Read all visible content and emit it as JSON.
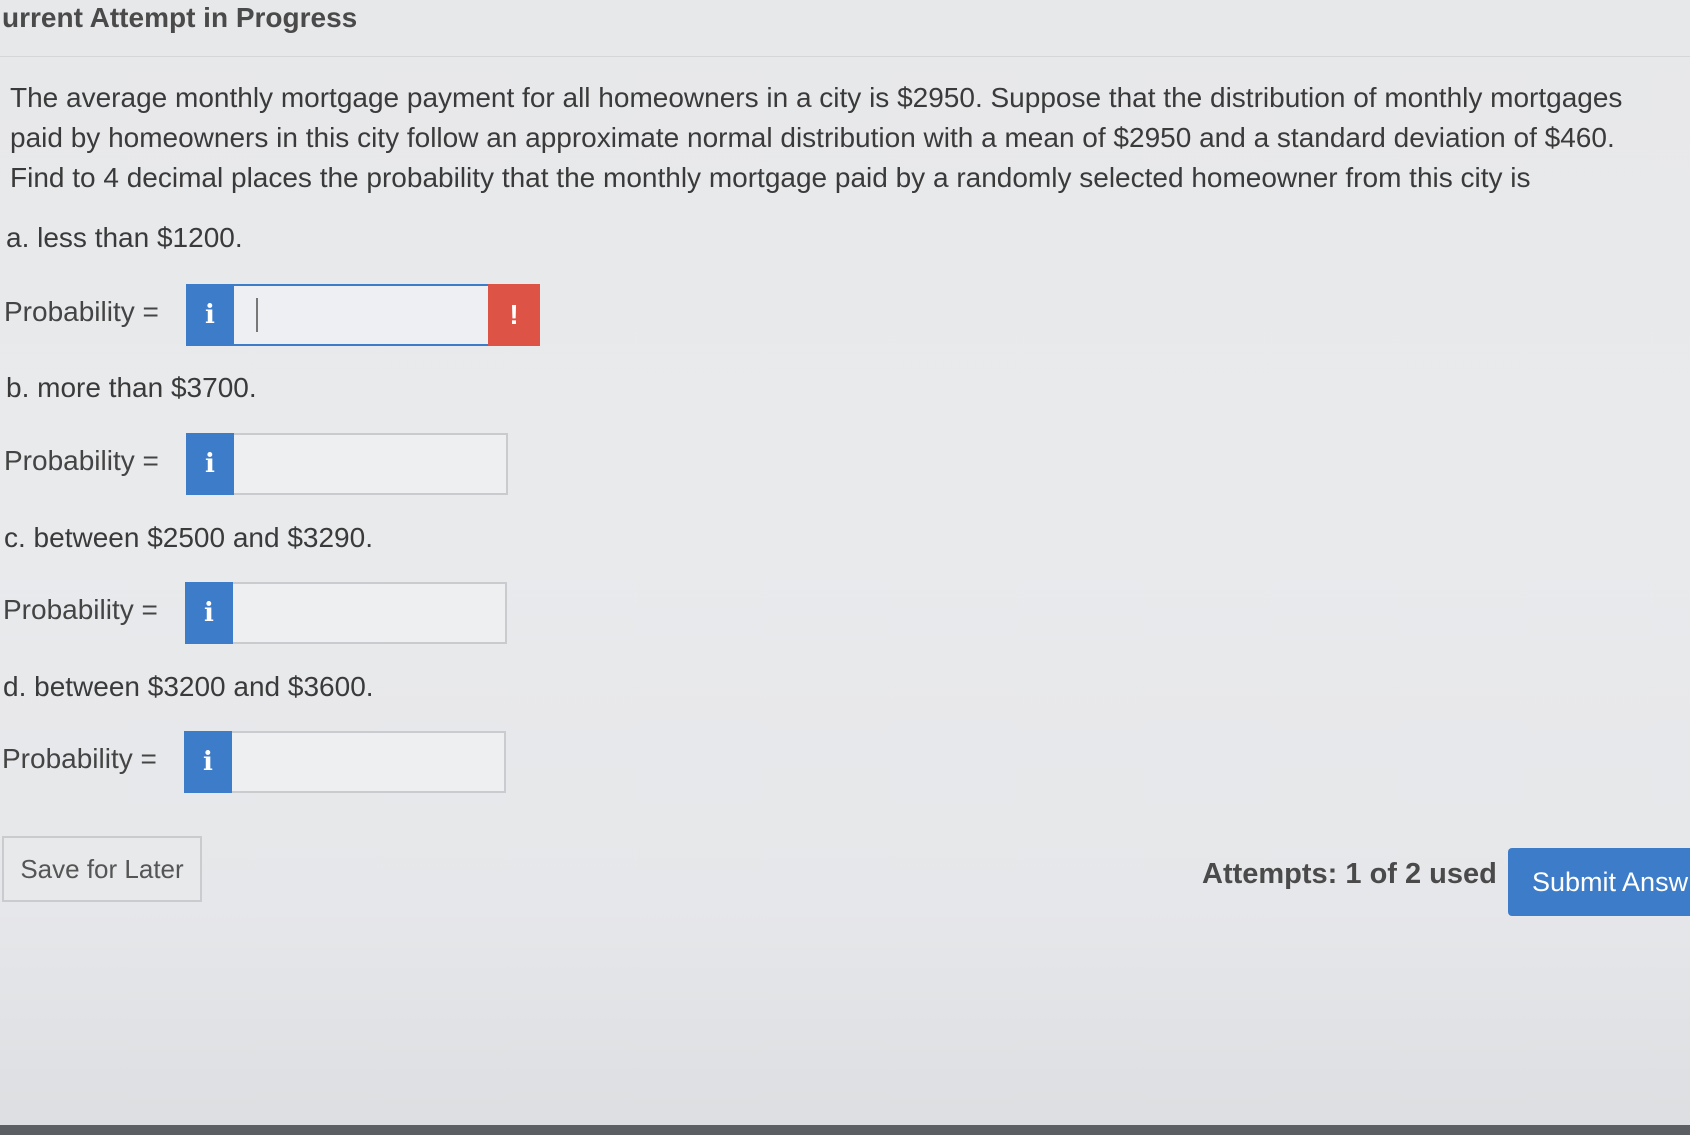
{
  "header": {
    "title": "urrent Attempt in Progress"
  },
  "question": {
    "lines": [
      "The average monthly mortgage payment for all homeowners in a city is $2950. Suppose that the distribution of monthly mortgages",
      "paid by homeowners in this city follow an approximate normal distribution with a mean of $2950 and a standard deviation of $460.",
      "Find to 4 decimal places the probability that the monthly mortgage paid by a randomly selected homeowner from this city is"
    ]
  },
  "parts": [
    {
      "label": "a. less than $1200.",
      "prob_label": "Probability =",
      "info": "i",
      "value": "",
      "alert": "!"
    },
    {
      "label": "b. more than $3700.",
      "prob_label": "Probability =",
      "info": "i",
      "value": ""
    },
    {
      "label": "c. between $2500 and $3290.",
      "prob_label": "Probability =",
      "info": "i",
      "value": ""
    },
    {
      "label": "d. between $3200 and $3600.",
      "prob_label": "Probability =",
      "info": "i",
      "value": ""
    }
  ],
  "footer": {
    "save_label": "Save for Later",
    "attempts": "Attempts: 1 of 2 used",
    "submit_label": "Submit Answ"
  },
  "colors": {
    "accent": "#3c7cc9",
    "alert": "#dd5446",
    "background": "#e8e9eb"
  }
}
